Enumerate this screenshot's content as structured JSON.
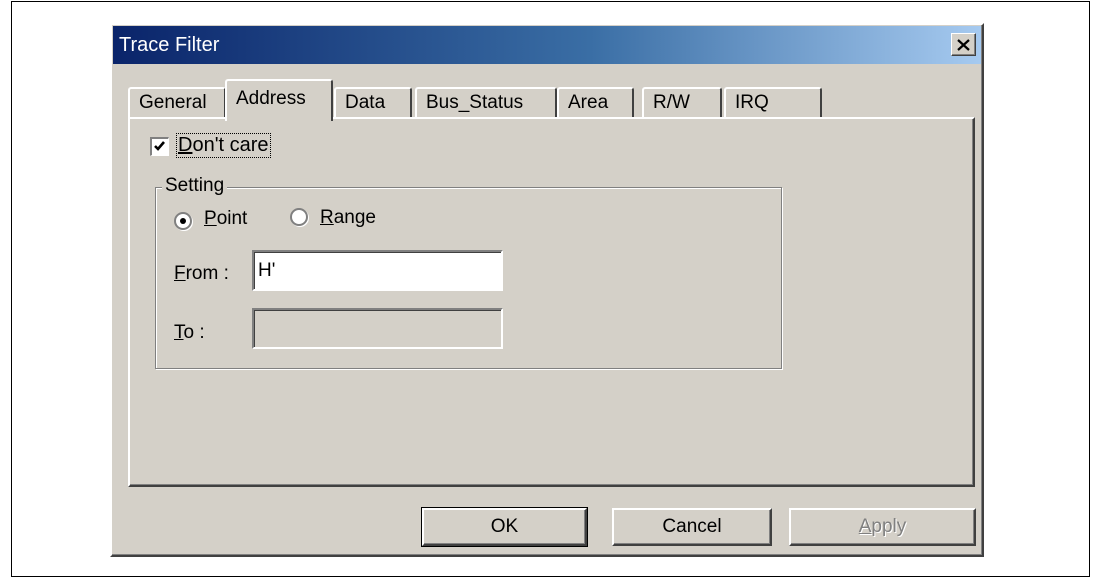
{
  "window": {
    "title": "Trace Filter"
  },
  "tabs": [
    {
      "label": "General",
      "active": false
    },
    {
      "label": "Address",
      "active": true
    },
    {
      "label": "Data",
      "active": false
    },
    {
      "label": "Bus_Status",
      "active": false
    },
    {
      "label": "Area",
      "active": false
    },
    {
      "label": "R/W",
      "active": false
    },
    {
      "label": "IRQ",
      "active": false
    }
  ],
  "dont_care": {
    "label_mnemonic": "D",
    "label_rest": "on't care",
    "checked": true
  },
  "setting": {
    "legend": "Setting",
    "point": {
      "mnemonic": "P",
      "rest": "oint",
      "selected": true
    },
    "range": {
      "mnemonic": "R",
      "rest": "ange",
      "selected": false
    },
    "from": {
      "mnemonic": "F",
      "rest": "rom :",
      "value": "H'"
    },
    "to": {
      "mnemonic": "T",
      "rest": "o :",
      "value": ""
    }
  },
  "buttons": {
    "ok": "OK",
    "cancel": "Cancel",
    "apply_mnemonic": "A",
    "apply_rest": "pply"
  },
  "icons": {
    "close": "close-icon",
    "check": "check-icon",
    "radio_dot": "radio-dot-icon"
  }
}
